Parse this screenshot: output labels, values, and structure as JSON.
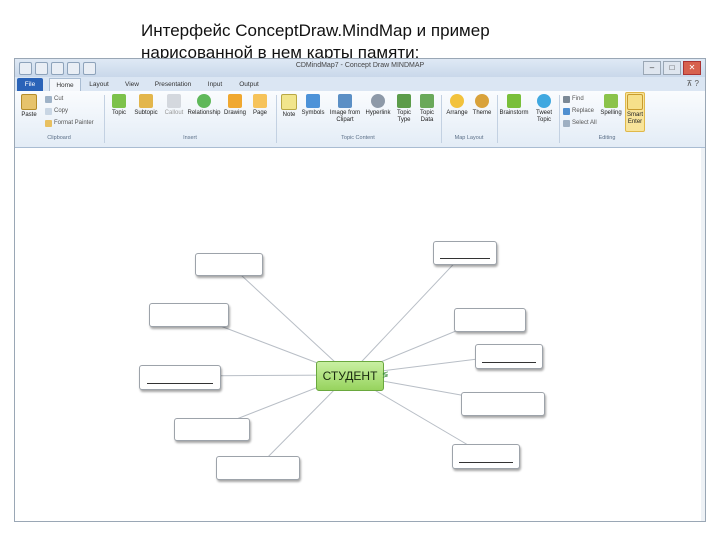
{
  "caption": {
    "line1": "Интерфейс ConceptDraw.MindMap и пример",
    "line2": "нарисованной в нем карты памяти:"
  },
  "window": {
    "title": "CDMindMap7 - Concept Draw MINDMAP",
    "controls": [
      "–",
      "□",
      "✕"
    ]
  },
  "tabs": [
    "File",
    "Home",
    "Layout",
    "View",
    "Presentation",
    "Input",
    "Output"
  ],
  "active_tab": "Home",
  "ribbon": {
    "clipboard": {
      "paste": "Paste",
      "cut": "Cut",
      "copy": "Copy",
      "format_painter": "Format Painter",
      "label": "Clipboard"
    },
    "insert": {
      "topic": "Topic",
      "subtopic": "Subtopic",
      "callout": "Callout",
      "relationship": "Relationship",
      "drawing": "Drawing",
      "page": "Page",
      "label": "Insert"
    },
    "topic_content": {
      "note": "Note",
      "symbols": "Symbols",
      "image_from_clipart": "Image from Clipart",
      "hyperlink": "Hyperlink",
      "topic_type": "Topic Type",
      "topic_data": "Topic Data",
      "label": "Topic Content"
    },
    "map_layout": {
      "arrange": "Arrange",
      "theme": "Theme",
      "label": "Map Layout"
    },
    "brainstorm": "Brainstorm",
    "tweet_topic": "Tweet Topic",
    "editing": {
      "find": "Find",
      "replace": "Replace",
      "select_all": "Select All",
      "spelling": "Spelling",
      "smart_enter": "Smart Enter",
      "label": "Editing"
    }
  },
  "mind_map": {
    "center_topic": "СТУДЕНТ",
    "center_color": "#a8e07a",
    "topic_count": 10
  },
  "colors": {
    "file_tab": "#2a63b8",
    "ribbon_bg": "#e3ecf6",
    "center_topic": "#a8e07a"
  }
}
